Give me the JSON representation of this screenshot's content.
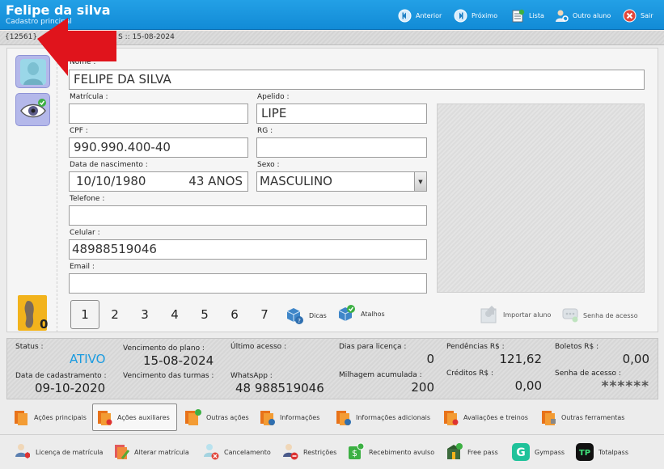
{
  "header": {
    "name": "Felipe da silva",
    "subtitle": "Cadastro principal",
    "nav": [
      {
        "label": "Anterior",
        "icon": "previous-icon"
      },
      {
        "label": "Próximo",
        "icon": "next-icon"
      },
      {
        "label": "Lista",
        "icon": "list-icon"
      },
      {
        "label": "Outro aluno",
        "icon": "user-search-icon"
      },
      {
        "label": "Sair",
        "icon": "exit-icon"
      }
    ]
  },
  "strip": {
    "id": "{12561}",
    "date_text": "S :: 15-08-2024"
  },
  "form": {
    "nome": {
      "label": "Nome :",
      "value": "FELIPE DA SILVA"
    },
    "matricula": {
      "label": "Matrícula :",
      "value": ""
    },
    "apelido": {
      "label": "Apelido :",
      "value": "LIPE"
    },
    "cpf": {
      "label": "CPF :",
      "value": "990.990.400-40"
    },
    "rg": {
      "label": "RG :",
      "value": ""
    },
    "nascimento": {
      "label": "Data de nascimento :",
      "value": "10/10/1980",
      "age": "43 ANOS"
    },
    "sexo": {
      "label": "Sexo :",
      "value": "MASCULINO"
    },
    "telefone": {
      "label": "Telefone :",
      "value": ""
    },
    "celular": {
      "label": "Celular :",
      "value": "48988519046"
    },
    "email": {
      "label": "Email :",
      "value": ""
    }
  },
  "pages": [
    "1",
    "2",
    "3",
    "4",
    "5",
    "6",
    "7"
  ],
  "actions": {
    "dicas": "Dicas",
    "atalhos": "Atalhos",
    "importar": "Importar aluno",
    "senha": "Senha de acesso"
  },
  "footprint_badge": "0",
  "summary": {
    "status": {
      "label": "Status :",
      "value": "ATIVO"
    },
    "cadastro": {
      "label": "Data de cadastramento :",
      "value": "09-10-2020"
    },
    "venc_plano": {
      "label": "Vencimento do plano :",
      "value": "15-08-2024"
    },
    "venc_turmas": {
      "label": "Vencimento das turmas :",
      "value": ""
    },
    "ultimo_acesso": {
      "label": "Último acesso :",
      "value": ""
    },
    "whatsapp": {
      "label": "WhatsApp :",
      "value": "48 988519046"
    },
    "dias_licenca": {
      "label": "Dias para licença :",
      "value": "0"
    },
    "milhagem": {
      "label": "Milhagem acumulada :",
      "value": "200"
    },
    "pendencias": {
      "label": "Pendências R$ :",
      "value": "121,62"
    },
    "creditos": {
      "label": "Créditos R$ :",
      "value": "0,00"
    },
    "boletos": {
      "label": "Boletos R$ :",
      "value": "0,00"
    },
    "senha": {
      "label": "Senha de acesso :",
      "value": "******"
    }
  },
  "tabs1": [
    "Ações principais",
    "Ações auxiliares",
    "Outras ações",
    "Informações",
    "Informações adicionais",
    "Avaliações e treinos",
    "Outras ferramentas"
  ],
  "tabs2": [
    "Licença de matrícula",
    "Alterar matrícula",
    "Cancelamento",
    "Restrições",
    "Recebimento avulso",
    "Free pass",
    "Gympass",
    "Totalpass"
  ],
  "colors": {
    "header": "#1696dd",
    "status_active": "#1a9be0",
    "arrow": "#e0141c"
  }
}
